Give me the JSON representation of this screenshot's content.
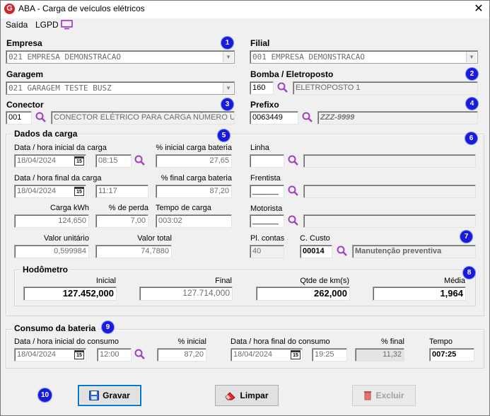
{
  "window": {
    "title": "ABA - Carga de veículos elétricos",
    "close": "✕",
    "logo": "G"
  },
  "menu": {
    "saida": "Saída",
    "lgpd": "LGPD"
  },
  "badges": [
    "1",
    "2",
    "3",
    "4",
    "5",
    "6",
    "7",
    "8",
    "9",
    "10"
  ],
  "empresa": {
    "label": "Empresa",
    "value": "021 EMPRESA DEMONSTRACAO"
  },
  "filial": {
    "label": "Filial",
    "value": "001 EMPRESA DEMONSTRACAO"
  },
  "garagem": {
    "label": "Garagem",
    "value": "021 GARAGEM TESTE BUSZ"
  },
  "bomba": {
    "label": "Bomba / Eletroposto",
    "code": "160",
    "desc": "ELETROPOSTO 1"
  },
  "conector": {
    "label": "Conector",
    "code": "001",
    "desc": "CONECTOR ELÉTRICO PARA CARGA NÚMERO UM"
  },
  "prefixo": {
    "label": "Prefixo",
    "code": "0063449",
    "plate": "ZZZ-9999"
  },
  "dados": {
    "title": "Dados da carga",
    "data_ini_label": "Data / hora inicial da carga",
    "data_ini": "18/04/2024",
    "hora_ini": "08:15",
    "pct_ini_label": "% inicial carga bateria",
    "pct_ini": "27,65",
    "data_fim_label": "Data / hora final da carga",
    "data_fim": "18/04/2024",
    "hora_fim": "11:17",
    "pct_fim_label": "% final carga bateria",
    "pct_fim": "87,20",
    "kwh_label": "Carga kWh",
    "kwh": "124,650",
    "perda_label": "% de perda",
    "perda": "7,00",
    "tempo_label": "Tempo de carga",
    "tempo": "003:02",
    "vunit_label": "Valor unitário",
    "vunit": "0,599984",
    "vtotal_label": "Valor total",
    "vtotal": "74,7880",
    "linha_label": "Linha",
    "frentista_label": "Frentista",
    "frentista": "______",
    "motorista_label": "Motorista",
    "motorista": "______",
    "plcontas_label": "Pl. contas",
    "plcontas": "40",
    "ccusto_label": "C. Custo",
    "ccusto": "00014",
    "ccusto_desc": "Manutenção preventiva"
  },
  "hodometro": {
    "title": "Hodômetro",
    "inicial_label": "Inicial",
    "inicial": "127.452,000",
    "final_label": "Final",
    "final": "127.714,000",
    "qtde_label": "Qtde de km(s)",
    "qtde": "262,000",
    "media_label": "Média",
    "media": "1,964"
  },
  "consumo": {
    "title": "Consumo da bateria",
    "data_ini_label": "Data / hora inicial do consumo",
    "data_ini": "18/04/2024",
    "hora_ini": "12:00",
    "pct_ini_label": "% inicial",
    "pct_ini": "87,20",
    "data_fim_label": "Data / hora final do consumo",
    "data_fim": "18/04/2024",
    "hora_fim": "19:25",
    "pct_fim_label": "% final",
    "pct_fim": "11,32",
    "tempo_label": "Tempo",
    "tempo": "007:25"
  },
  "buttons": {
    "gravar": "Gravar",
    "limpar": "Limpar",
    "excluir": "Excluir"
  },
  "calendar_text": "15",
  "colors": {
    "badge": "#1a1adb",
    "focus": "#0078d7",
    "search": "#a040c0",
    "logo": "#d0232b"
  }
}
